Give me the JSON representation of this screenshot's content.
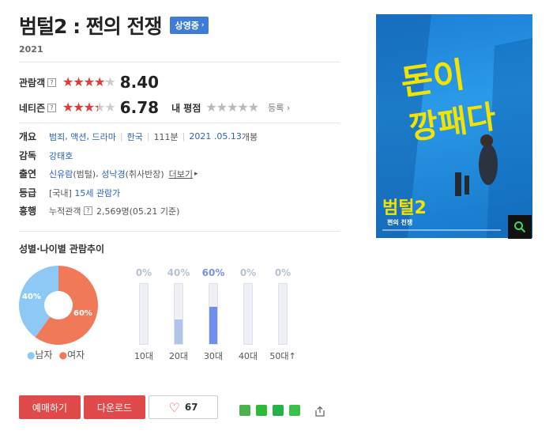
{
  "movie": {
    "title": "범털2 : 쩐의 전쟁",
    "status_badge": "상영중",
    "year": "2021"
  },
  "ratings": {
    "audience": {
      "label": "관람객",
      "help": "?",
      "score": "8.40",
      "fill_fraction": 0.84
    },
    "netizen": {
      "label": "네티즌",
      "help": "?",
      "score": "6.78",
      "fill_fraction": 0.678
    },
    "my_rating": {
      "label": "내 평점",
      "register": "등록",
      "fill_fraction": 0
    }
  },
  "info": {
    "overview": {
      "key": "개요",
      "genres": [
        "범죄",
        "액션",
        "드라마"
      ],
      "country": "한국",
      "runtime": "111분",
      "release_date": "2021 .05.13",
      "release_suffix": "개봉"
    },
    "director": {
      "key": "감독",
      "name": "강태호"
    },
    "cast": {
      "key": "출연",
      "actor1": "신유람",
      "role1": "(범털)",
      "actor2": "성낙경",
      "role2": "(취사반장)",
      "more": "더보기"
    },
    "grade": {
      "key": "등급",
      "prefix": "[국내]",
      "value": "15세 관람가"
    },
    "box_office": {
      "key": "흥행",
      "label": "누적관객",
      "help": "?",
      "count": "2,569명",
      "asof": "(05.21 기준)"
    }
  },
  "demographics": {
    "section_title": "성별·나이별 관람추이",
    "gender": {
      "male_pct": "40%",
      "female_pct": "60%",
      "male_fraction": 0.4,
      "male_color": "#8ec9f5",
      "female_color": "#f0795a",
      "legend_male": "남자",
      "legend_female": "여자"
    },
    "age_groups": [
      {
        "label": "10대",
        "pct": "0%",
        "value": 0,
        "fill_color": "#b8c8e6",
        "pct_color": "#b8c0d8"
      },
      {
        "label": "20대",
        "pct": "40%",
        "value": 40,
        "fill_color": "#b3c4ea",
        "pct_color": "#b8c0d8"
      },
      {
        "label": "30대",
        "pct": "60%",
        "value": 60,
        "fill_color": "#6f8ef0",
        "pct_color": "#7d8fe3"
      },
      {
        "label": "40대",
        "pct": "0%",
        "value": 0,
        "fill_color": "#b8c8e6",
        "pct_color": "#b8c0d8"
      },
      {
        "label": "50대↑",
        "pct": "0%",
        "value": 0,
        "fill_color": "#b8c8e6",
        "pct_color": "#b8c0d8"
      }
    ]
  },
  "actions": {
    "reserve": "예매하기",
    "download": "다운로드",
    "like_count": "67"
  },
  "share_icons": [
    {
      "name": "share-line-icon",
      "color": "#4db24d"
    },
    {
      "name": "share-naver-icon",
      "color": "#2fba3a"
    },
    {
      "name": "share-band-icon",
      "color": "#28b04a"
    },
    {
      "name": "share-blog-icon",
      "color": "#3cc04a"
    }
  ],
  "poster": {
    "headline_line1": "돈이",
    "headline_line2": "깡패다",
    "logo": "범털2",
    "logo_sub": "쩐의 전쟁",
    "bg_color": "#2a94e4",
    "text_color": "#f2e400"
  }
}
